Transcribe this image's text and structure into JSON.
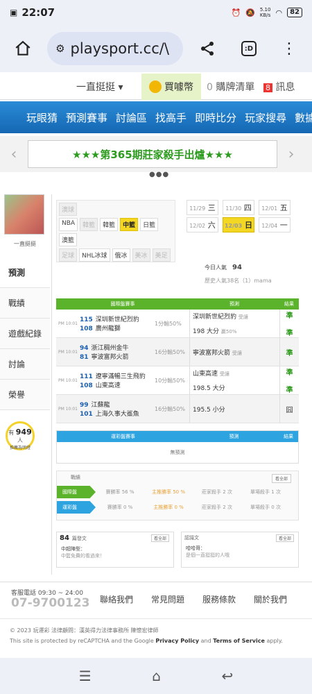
{
  "status": {
    "time": "22:07",
    "battery": "82",
    "speed": "5.10\nKB/s"
  },
  "browser": {
    "url": "playsport.cc/\\",
    "tab_label": ":D"
  },
  "site_top": {
    "user": "一直挺挺 ▾",
    "coin_label": "買噱幣",
    "cart_count": "0",
    "cart_label": "購牌清單",
    "msg_count": "8",
    "msg_label": "訊息"
  },
  "nav": {
    "items": [
      "玩眼猜",
      "預測賽事",
      "討論區",
      "找高手",
      "即時比分",
      "玩家搜尋",
      "數據"
    ]
  },
  "banner": {
    "text": "★★★第365期莊家殺手出爐★★★"
  },
  "left": {
    "avatar_name": "一直挺挺",
    "menu": [
      "預測",
      "戰績",
      "遊戲紀錄",
      "討論",
      "榮譽"
    ],
    "bulb_pre": "有",
    "bulb_count": "949",
    "bulb_post": "人",
    "bulb_sub": "推薦為明燈"
  },
  "filters": {
    "row1": [
      "澳球"
    ],
    "row2": [
      "NBA",
      "韓籃",
      "韓籃",
      "中籃",
      "日籃"
    ],
    "row3": [
      "澳籃"
    ],
    "row4": [
      "足球",
      "NHL冰球",
      "俄冰",
      "美冰",
      "美足"
    ]
  },
  "dates": [
    {
      "md": "11/29",
      "wd": "三"
    },
    {
      "md": "11/30",
      "wd": "四"
    },
    {
      "md": "12/01",
      "wd": "五"
    },
    {
      "md": "12/02",
      "wd": "六"
    },
    {
      "md": "12/03",
      "wd": "日"
    },
    {
      "md": "12/04",
      "wd": "一"
    }
  ],
  "today": {
    "label": "今日人氣",
    "count": "94",
    "sub": "歷史人氣38名（1）mama"
  },
  "table": {
    "head": [
      "國際盤賽事",
      "預測",
      "結果"
    ],
    "rows": [
      {
        "league": "PM 10:01",
        "t1n": "115",
        "t1": "深圳新世紀烈豹",
        "t2n": "108",
        "t2": "廣州龍獅",
        "odds": "1分輸50%",
        "pick1": "深圳新世紀烈豹",
        "pick1g": "受讓",
        "pick2": "198 大分",
        "pick2g": "贏50%",
        "res1": "準",
        "res2": "準"
      },
      {
        "league": "PM 10:01",
        "t1n": "94",
        "t1": "浙江稠州金牛",
        "t2n": "81",
        "t2": "寧波富邦火箭",
        "odds": "16分輸50%",
        "pick1": "寧波富邦火箭",
        "pick1g": "受讓",
        "pick2": "",
        "pick2g": "",
        "res1": "準",
        "res2": ""
      },
      {
        "league": "PM 10:01",
        "t1n": "111",
        "t1": "遼寧滿暢三生飛豹",
        "t2n": "108",
        "t2": "山東高速",
        "odds": "10分輸50%",
        "pick1": "山東高速",
        "pick1g": "受讓",
        "pick2": "198.5 大分",
        "pick2g": "",
        "res1": "準",
        "res2": "準"
      },
      {
        "league": "PM 10:01",
        "t1n": "99",
        "t1": "江蘇龍",
        "t2n": "101",
        "t2": "上海久事大鯊魚",
        "odds": "16分輸50%",
        "pick1": "195.5 小分",
        "pick1g": "",
        "pick2": "",
        "pick2g": "",
        "res1": "囧",
        "res2": ""
      }
    ]
  },
  "table2": {
    "head": [
      "運彩盤賽事",
      "預測",
      "結果"
    ],
    "empty": "無預測"
  },
  "stats": {
    "title": "戰績",
    "more": "看全部",
    "rows": [
      {
        "label": "國際盤",
        "color": "#5bb32b",
        "c1": "賽勝率 56 %",
        "c2": "主推勝率 50 %",
        "c3": "莊家殺手 2 次",
        "c4": "單場殺手 1 次"
      },
      {
        "label": "運彩盤",
        "color": "#2da3e0",
        "c1": "賽勝率 0 %",
        "c2": "主推勝率 0 %",
        "c3": "莊家殺手 2 次",
        "c4": "單場殺手 0 次"
      }
    ]
  },
  "box1": {
    "count": "84",
    "label": "篇發文",
    "btn": "看全部",
    "line1": "中超陣型：",
    "line2": "中籃免費的看過來！"
  },
  "box2": {
    "label": "認識文",
    "btn": "看全部",
    "line1": "哈哈哥：",
    "line2": "是個一直挺挺的人哦"
  },
  "footer": {
    "contact": "客服電話 09:30 ~ 24:00",
    "phone": "07-9700123",
    "links": [
      "聯絡我們",
      "常見問題",
      "服務條款",
      "關於我們"
    ],
    "copy": "© 2023 玩運彩 法律顧問：漢英得力法律事務所 陳懷宏律師",
    "recap_pre": "This site is protected by reCAPTCHA and the Google",
    "privacy": "Privacy Policy",
    "and": "and",
    "terms": "Terms of Service",
    "apply": "apply."
  }
}
